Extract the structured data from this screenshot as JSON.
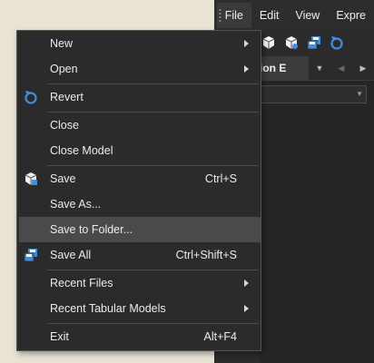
{
  "menubar": {
    "items": [
      {
        "label": "File",
        "active": true
      },
      {
        "label": "Edit"
      },
      {
        "label": "View"
      },
      {
        "label": "Expre"
      }
    ]
  },
  "tabs": {
    "active_label": "ion E"
  },
  "file_menu": {
    "items": [
      {
        "label": "New",
        "shortcut": "",
        "submenu": true,
        "icon": ""
      },
      {
        "label": "Open",
        "shortcut": "",
        "submenu": true,
        "icon": ""
      },
      {
        "label": "Revert",
        "shortcut": "",
        "submenu": false,
        "icon": "revert-icon"
      },
      {
        "label": "Close",
        "shortcut": "",
        "submenu": false,
        "icon": ""
      },
      {
        "label": "Close Model",
        "shortcut": "",
        "submenu": false,
        "icon": ""
      },
      {
        "label": "Save",
        "shortcut": "Ctrl+S",
        "submenu": false,
        "icon": "save-icon"
      },
      {
        "label": "Save As...",
        "shortcut": "",
        "submenu": false,
        "icon": ""
      },
      {
        "label": "Save to Folder...",
        "shortcut": "",
        "submenu": false,
        "icon": "",
        "highlighted": true
      },
      {
        "label": "Save All",
        "shortcut": "Ctrl+Shift+S",
        "submenu": false,
        "icon": "save-all-icon"
      },
      {
        "label": "Recent Files",
        "shortcut": "",
        "submenu": true,
        "icon": ""
      },
      {
        "label": "Recent Tabular Models",
        "shortcut": "",
        "submenu": true,
        "icon": ""
      },
      {
        "label": "Exit",
        "shortcut": "Alt+F4",
        "submenu": false,
        "icon": ""
      }
    ]
  },
  "colors": {
    "menu_bg": "#2b2b2b",
    "highlight": "#4a4a4a",
    "icon_blue": "#3d8fe0"
  }
}
